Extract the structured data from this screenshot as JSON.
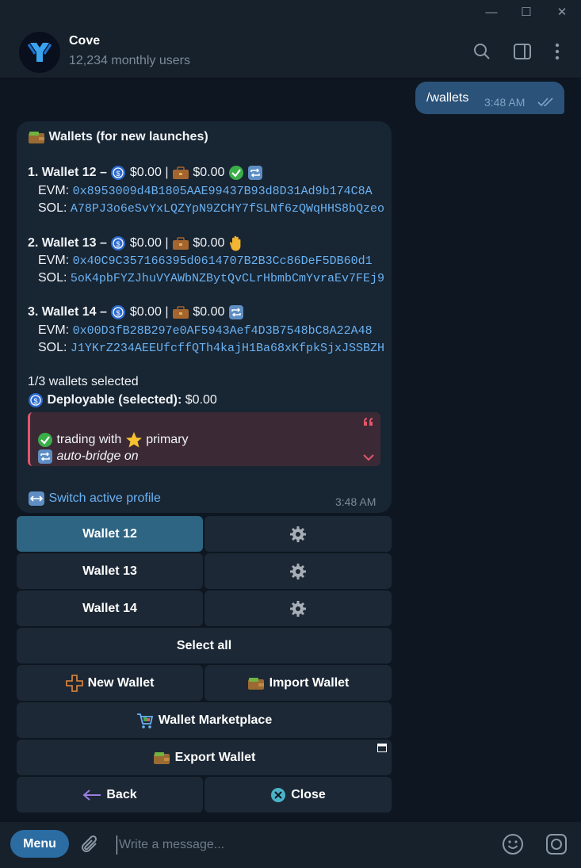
{
  "window": {
    "minimize": "—",
    "maximize": "☐",
    "close": "✕"
  },
  "header": {
    "name": "Cove",
    "subtitle": "12,234 monthly users"
  },
  "outgoing": {
    "text": "/wallets",
    "time": "3:48 AM"
  },
  "message": {
    "title": "Wallets (for new launches)",
    "wallets": [
      {
        "label": "1. Wallet 12 –",
        "usd": "$0.00",
        "sep": "|",
        "bag": "$0.00",
        "evm_label": "EVM:",
        "evm": "0x8953009d4B1805AAE99437B93d8D31Ad9b174C8A",
        "sol_label": "SOL:",
        "sol": "A78PJ3o6eSvYxLQZYpN9ZCHY7fSLNf6zQWqHHS8bQzeo"
      },
      {
        "label": "2. Wallet 13 –",
        "usd": "$0.00",
        "sep": "|",
        "bag": "$0.00",
        "evm_label": "EVM:",
        "evm": "0x40C9C357166395d0614707B2B3Cc86DeF5DB60d1",
        "sol_label": "SOL:",
        "sol": "5oK4pbFYZJhuVYAWbNZBytQvCLrHbmbCmYvraEv7FEj9"
      },
      {
        "label": "3. Wallet 14 –",
        "usd": "$0.00",
        "sep": "|",
        "bag": "$0.00",
        "evm_label": "EVM:",
        "evm": "0x00D3fB28B297e0AF5943Aef4D3B7548bC8A22A48",
        "sol_label": "SOL:",
        "sol": "J1YKrZ234AEEUfcffQTh4kajH1Ba68xKfpkSjxJSSBZH"
      }
    ],
    "selected_count": "1/3 wallets selected",
    "deployable_label": "Deployable (selected):",
    "deployable_value": "$0.00",
    "quote_line1": "trading with",
    "quote_primary": "primary",
    "quote_line2": "auto-bridge on",
    "switch_profile": "Switch active profile",
    "time": "3:48 AM"
  },
  "keyboard": {
    "wallet12": "Wallet 12",
    "wallet13": "Wallet 13",
    "wallet14": "Wallet 14",
    "select_all": "Select all",
    "new_wallet": "New Wallet",
    "import_wallet": "Import Wallet",
    "marketplace": "Wallet Marketplace",
    "export_wallet": "Export Wallet",
    "back": "Back",
    "close": "Close"
  },
  "input": {
    "menu": "Menu",
    "placeholder": "Write a message..."
  },
  "colors": {
    "accent": "#2b6ca3",
    "bubble_out": "#2b5278",
    "bubble_in": "#182533",
    "link": "#6ab2f2",
    "quote": "#e2566a"
  }
}
